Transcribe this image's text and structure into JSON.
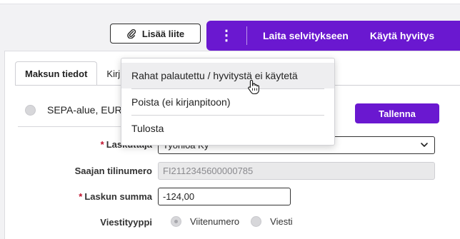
{
  "header": {
    "attach_button": "Lisää liite",
    "more_menu_glyph": "⋮",
    "report_button": "Laita selvitykseen",
    "use_credit_button": "Käytä hyvitys"
  },
  "tabs": [
    {
      "label": "Maksun tiedot",
      "active": true
    },
    {
      "label": "Kirj",
      "active": false
    }
  ],
  "payment": {
    "area_label": "SEPA-alue, EUR",
    "save_button": "Tallenna"
  },
  "form": {
    "biller_label": "Laskuttaja",
    "biller_value": "Työnloa Ky",
    "account_label": "Saajan tilinumero",
    "account_value": "FI2112345600000785",
    "amount_label": "Laskun summa",
    "amount_value": "-124,00",
    "message_type_label": "Viestityyppi",
    "message_type_options": [
      "Viitenumero",
      "Viesti"
    ],
    "required_marker": "*"
  },
  "dropdown": {
    "items": [
      "Rahat palautettu / hyvitystä ei käytetä",
      "Poista (ei kirjanpitoon)",
      "Tulosta"
    ],
    "hovered_index": 0
  },
  "colors": {
    "accent": "#6a18d0",
    "required": "#c0112d",
    "disabled_bg": "#e9e9ea"
  },
  "icons": {
    "attach": "paperclip-icon",
    "more": "kebab-menu-icon",
    "select_arrow": "chevron-down-icon",
    "pointer": "hand-cursor-icon"
  }
}
